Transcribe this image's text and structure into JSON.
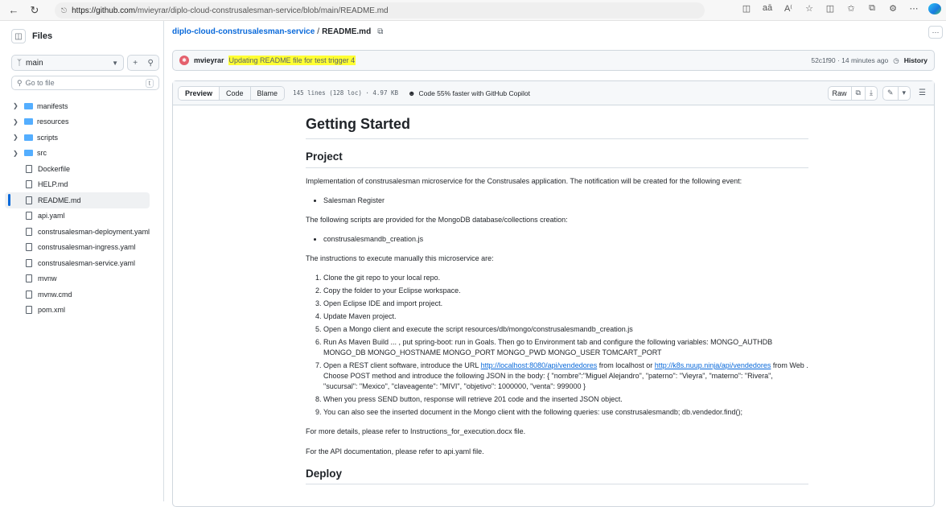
{
  "browser": {
    "url_host": "https://github.com",
    "url_path": "/mvieyrar/diplo-cloud-construsalesman-service/blob/main/README.md",
    "icons": [
      "split-icon",
      "read-aloud-icon",
      "text-size-icon",
      "favorite-icon",
      "sidebar-icon",
      "favorites-bar-icon",
      "collections-icon",
      "extensions-icon",
      "more-icon",
      "edge-copilot-icon"
    ]
  },
  "sidebar": {
    "title": "Files",
    "branch": "main",
    "goto_placeholder": "Go to file",
    "goto_kbd": "t",
    "tree": [
      {
        "type": "folder",
        "label": "manifests"
      },
      {
        "type": "folder",
        "label": "resources"
      },
      {
        "type": "folder",
        "label": "scripts"
      },
      {
        "type": "folder",
        "label": "src"
      },
      {
        "type": "file",
        "label": "Dockerfile"
      },
      {
        "type": "file",
        "label": "HELP.md"
      },
      {
        "type": "file",
        "label": "README.md",
        "active": true
      },
      {
        "type": "file",
        "label": "api.yaml"
      },
      {
        "type": "file",
        "label": "construsalesman-deployment.yaml"
      },
      {
        "type": "file",
        "label": "construsalesman-ingress.yaml"
      },
      {
        "type": "file",
        "label": "construsalesman-service.yaml"
      },
      {
        "type": "file",
        "label": "mvnw"
      },
      {
        "type": "file",
        "label": "mvnw.cmd"
      },
      {
        "type": "file",
        "label": "pom.xml"
      }
    ]
  },
  "header": {
    "repo": "diplo-cloud-construsalesman-service",
    "separator": "/",
    "file": "README.md"
  },
  "commit": {
    "author": "mvieyrar",
    "message": "Updating README file for test trigger 4",
    "meta": "52c1f90 · 14 minutes ago",
    "history": "History",
    "highlight_color": "#ffff33"
  },
  "toolbar": {
    "preview": "Preview",
    "code": "Code",
    "blame": "Blame",
    "meta": "145 lines (128 loc) · 4.97 KB",
    "copilot": "Code 55% faster with GitHub Copilot",
    "raw": "Raw"
  },
  "readme": {
    "h1": "Getting Started",
    "h2_project": "Project",
    "p1": "Implementation of construsalesman microservice for the Construsales application. The notification will be created for the following event:",
    "bullet1": "Salesman Register",
    "p2": "The following scripts are provided for the MongoDB database/collections creation:",
    "bullet2": "construsalesmandb_creation.js",
    "p3": "The instructions to execute manually this microservice are:",
    "steps": {
      "s1": "Clone the git repo to your local repo.",
      "s2": "Copy the folder to your Eclipse workspace.",
      "s3": "Open Eclipse IDE and import project.",
      "s4": "Update Maven project.",
      "s5": "Open a Mongo client and execute the script resources/db/mongo/construsalesmandb_creation.js",
      "s6": "Run As Maven Build ... , put spring-boot: run in Goals. Then go to Environment tab and configure the following variables: MONGO_AUTHDB MONGO_DB MONGO_HOSTNAME MONGO_PORT MONGO_PWD MONGO_USER TOMCART_PORT",
      "s7_a": "Open a REST client software, introduce the URL ",
      "s7_link1": "http://localhost:8080/api/vendedores",
      "s7_b": " from localhost or ",
      "s7_link2": "http://k8s.nuup.ninja/api/vendedores",
      "s7_c": " from Web . Choose POST method and introduce the following JSON in the body: { \"nombre\":\"Miguel Alejandro\", \"paterno\": \"Vieyra\", \"materno\": \"Rivera\", \"sucursal\": \"Mexico\", \"claveagente\": \"MIVI\", \"objetivo\": 1000000, \"venta\": 999000 }",
      "s8": "When you press SEND button, response will retrieve 201 code and the inserted JSON object.",
      "s9": "You can also see the inserted document in the Mongo client with the following queries: use construsalesmandb; db.vendedor.find();"
    },
    "p4": "For more details, please refer to Instructions_for_execution.docx file.",
    "p5": "For the API documentation, please refer to api.yaml file.",
    "h2_deploy": "Deploy"
  }
}
